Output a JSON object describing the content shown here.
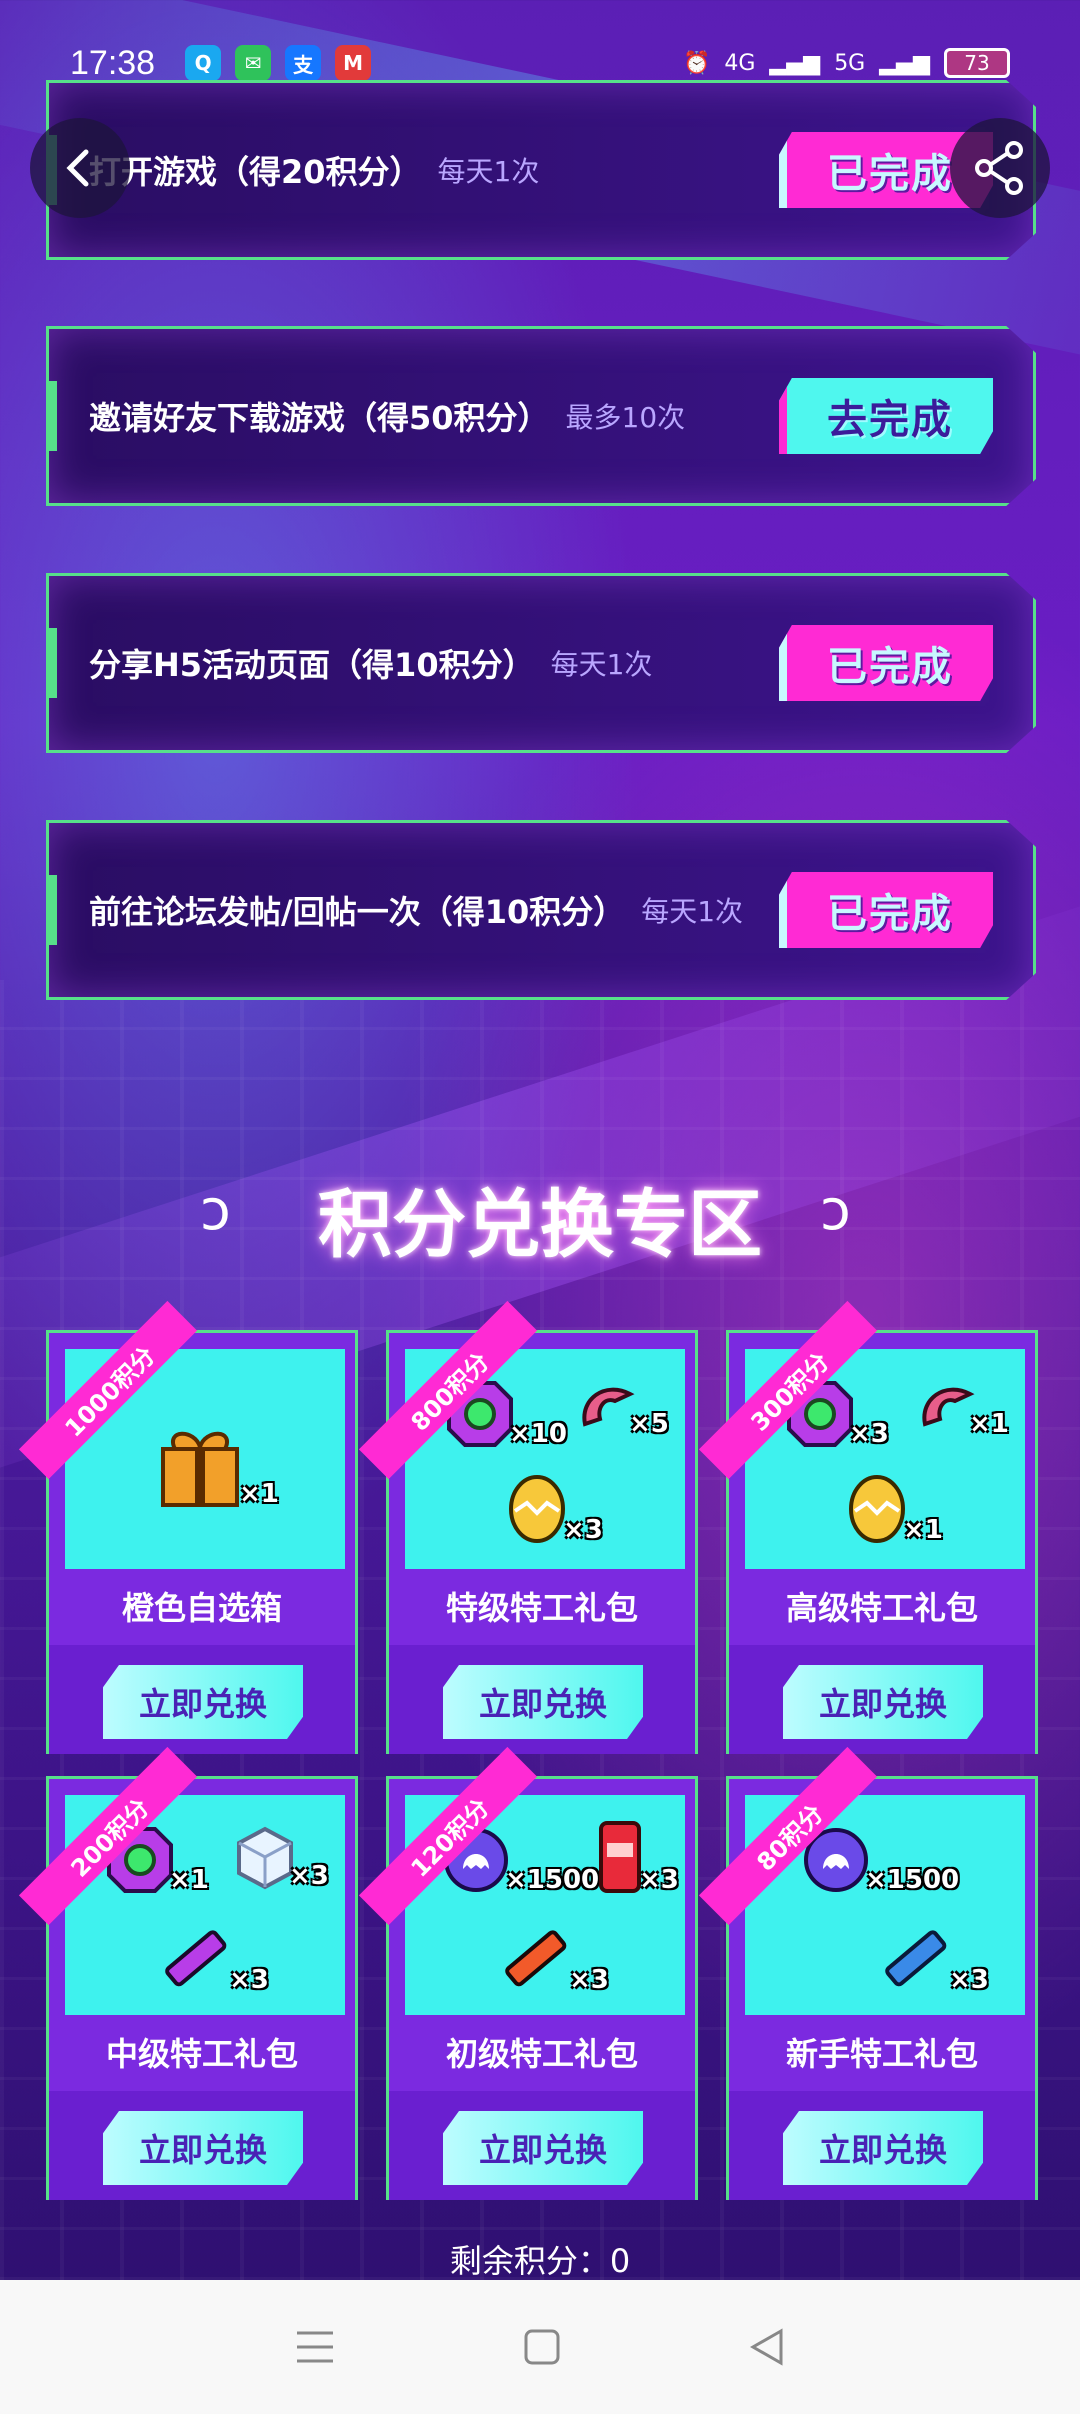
{
  "status_bar": {
    "time": "17:38",
    "signal1": "4G",
    "signal2": "5G",
    "battery": "73"
  },
  "tasks": [
    {
      "title": "打开游戏（得20积分）",
      "sub": "每天1次",
      "button": "已完成",
      "state": "done"
    },
    {
      "title": "邀请好友下载游戏（得50积分）",
      "sub": "最多10次",
      "button": "去完成",
      "state": "todo"
    },
    {
      "title": "分享H5活动页面（得10积分）",
      "sub": "每天1次",
      "button": "已完成",
      "state": "done"
    },
    {
      "title": "前往论坛发帖/回帖一次（得10积分）",
      "sub": "每天1次",
      "button": "已完成",
      "state": "done"
    }
  ],
  "section_title": "积分兑换专区",
  "products": [
    {
      "ribbon": "1000积分",
      "name": "橙色自选箱",
      "button": "立即兑换",
      "items": [
        {
          "icon": "orange-chest-icon",
          "qty": "×1"
        }
      ]
    },
    {
      "ribbon": "800积分",
      "name": "特级特工礼包",
      "button": "立即兑换",
      "items": [
        {
          "icon": "chip-icon",
          "qty": "×10"
        },
        {
          "icon": "claw-icon",
          "qty": "×5"
        },
        {
          "icon": "egg-icon",
          "qty": "×3"
        }
      ]
    },
    {
      "ribbon": "300积分",
      "name": "高级特工礼包",
      "button": "立即兑换",
      "items": [
        {
          "icon": "chip-icon",
          "qty": "×3"
        },
        {
          "icon": "claw-icon",
          "qty": "×1"
        },
        {
          "icon": "egg-icon",
          "qty": "×1"
        }
      ]
    },
    {
      "ribbon": "200积分",
      "name": "中级特工礼包",
      "button": "立即兑换",
      "items": [
        {
          "icon": "chip-icon",
          "qty": "×1"
        },
        {
          "icon": "ice-cube-icon",
          "qty": "×3"
        },
        {
          "icon": "purple-gun-icon",
          "qty": "×3"
        }
      ]
    },
    {
      "ribbon": "120积分",
      "name": "初级特工礼包",
      "button": "立即兑换",
      "items": [
        {
          "icon": "ghost-coin-icon",
          "qty": "×1500"
        },
        {
          "icon": "red-can-icon",
          "qty": "×3"
        },
        {
          "icon": "orange-gun-icon",
          "qty": "×3"
        }
      ]
    },
    {
      "ribbon": "80积分",
      "name": "新手特工礼包",
      "button": "立即兑换",
      "items": [
        {
          "icon": "ghost-coin-icon",
          "qty": "×1500"
        },
        {
          "icon": "blue-gun-icon",
          "qty": "×3"
        }
      ]
    }
  ],
  "remaining_points_label": "剩余积分：",
  "remaining_points_value": "0",
  "colors": {
    "accent": "#ff2ad4",
    "cyan": "#4ff7ee",
    "border": "#57e08a",
    "background": "#5b1fb5"
  }
}
